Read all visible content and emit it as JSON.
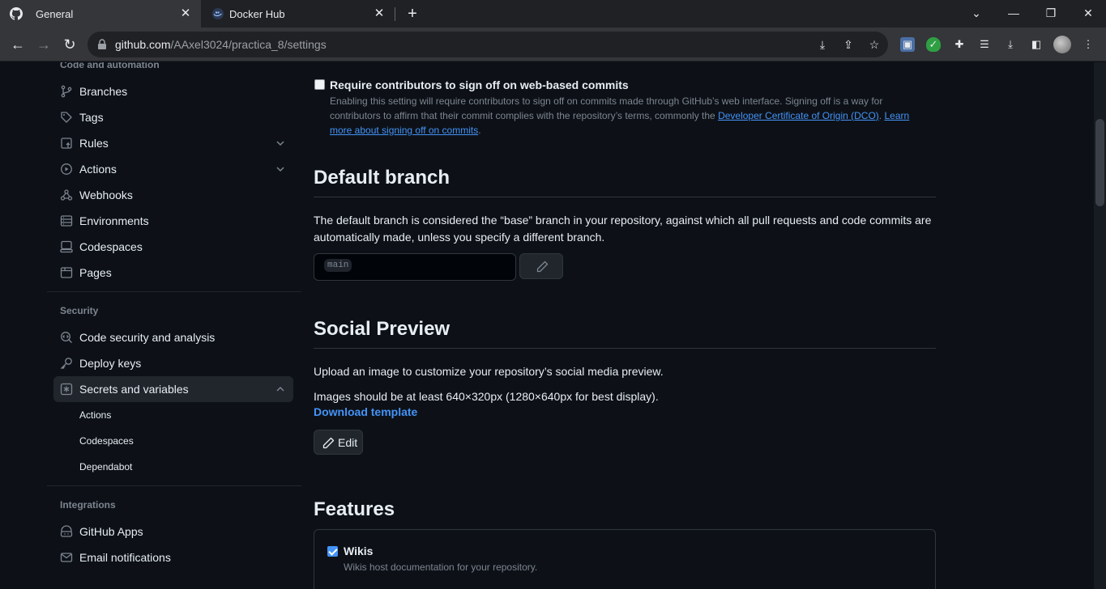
{
  "browser": {
    "tabs": [
      {
        "title": "General",
        "active": true,
        "icon": "github-icon"
      },
      {
        "title": "Docker Hub",
        "active": false,
        "icon": "docker-icon"
      }
    ],
    "url_host": "github.com",
    "url_path": "/AAxel3024/practica_8/settings"
  },
  "sidebar": {
    "code_heading": "Code and automation",
    "code_items": [
      {
        "label": "Branches",
        "icon": "git-branch-icon"
      },
      {
        "label": "Tags",
        "icon": "tag-icon"
      },
      {
        "label": "Rules",
        "icon": "rules-icon",
        "expandable": true
      },
      {
        "label": "Actions",
        "icon": "play-icon",
        "expandable": true
      },
      {
        "label": "Webhooks",
        "icon": "webhook-icon"
      },
      {
        "label": "Environments",
        "icon": "server-icon"
      },
      {
        "label": "Codespaces",
        "icon": "codespaces-icon"
      },
      {
        "label": "Pages",
        "icon": "browser-icon"
      }
    ],
    "security_heading": "Security",
    "security_items": [
      {
        "label": "Code security and analysis",
        "icon": "codescan-icon"
      },
      {
        "label": "Deploy keys",
        "icon": "key-icon"
      },
      {
        "label": "Secrets and variables",
        "icon": "asterisk-icon",
        "expanded": true,
        "selected": true
      }
    ],
    "secrets_subitems": [
      "Actions",
      "Codespaces",
      "Dependabot"
    ],
    "integrations_heading": "Integrations",
    "integration_items": [
      {
        "label": "GitHub Apps",
        "icon": "apps-icon"
      },
      {
        "label": "Email notifications",
        "icon": "mail-icon"
      }
    ]
  },
  "signoff": {
    "title": "Require contributors to sign off on web-based commits",
    "checked": false,
    "desc_1": "Enabling this setting will require contributors to sign off on commits made through GitHub’s web interface. Signing off is a way for contributors to affirm that their commit complies with the repository’s terms, commonly the ",
    "dco_link": "Developer Certificate of Origin (DCO)",
    "desc_2": ". ",
    "learn_link": "Learn more about signing off on commits",
    "desc_3": "."
  },
  "default_branch": {
    "heading": "Default branch",
    "description": "The default branch is considered the “base” branch in your repository, against which all pull requests and code commits are automatically made, unless you specify a different branch.",
    "branch": "main"
  },
  "social_preview": {
    "heading": "Social Preview",
    "upload_text": "Upload an image to customize your repository’s social media preview.",
    "size_text": "Images should be at least 640×320px (1280×640px for best display).",
    "download_link": "Download template",
    "edit_label": "Edit"
  },
  "features": {
    "heading": "Features",
    "wikis_title": "Wikis",
    "wikis_checked": true,
    "wikis_desc": "Wikis host documentation for your repository."
  },
  "colors": {
    "accent": "#4493f8",
    "background": "#0d1117",
    "border": "#30363d",
    "muted": "#7d8590"
  }
}
